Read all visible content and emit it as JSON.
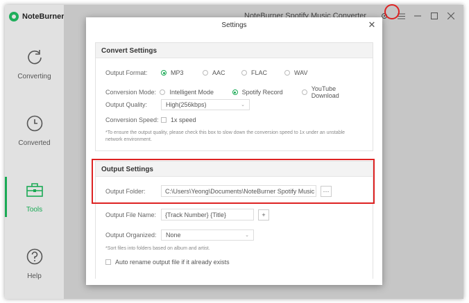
{
  "app": {
    "brand": "NoteBurner",
    "window_title": "NoteBurner Spotify Music Converter"
  },
  "sidebar": {
    "items": [
      {
        "label": "Converting",
        "icon": "refresh-icon"
      },
      {
        "label": "Converted",
        "icon": "clock-icon"
      },
      {
        "label": "Tools",
        "icon": "toolbox-icon"
      },
      {
        "label": "Help",
        "icon": "help-icon"
      }
    ],
    "active": "Tools"
  },
  "window_controls": {
    "settings_icon": "gear-icon",
    "menu_icon": "menu-icon",
    "minimize_icon": "minimize-icon",
    "maximize_icon": "maximize-icon",
    "close_icon": "close-icon"
  },
  "dialog": {
    "title": "Settings",
    "convert_settings": {
      "heading": "Convert Settings",
      "output_format": {
        "label": "Output Format:",
        "options": [
          "MP3",
          "AAC",
          "FLAC",
          "WAV"
        ],
        "selected": "MP3"
      },
      "conversion_mode": {
        "label": "Conversion Mode:",
        "options": [
          "Intelligent Mode",
          "Spotify Record",
          "YouTube Download"
        ],
        "selected": "Spotify Record"
      },
      "output_quality": {
        "label": "Output Quality:",
        "value": "High(256kbps)"
      },
      "conversion_speed": {
        "label": "Conversion Speed:",
        "checkbox_label": "1x speed",
        "checked": false
      },
      "speed_note": "*To ensure the output quality, please check this box to slow down the conversion speed to 1x under an unstable network environment."
    },
    "output_settings": {
      "heading": "Output Settings",
      "output_folder": {
        "label": "Output Folder:",
        "value": "C:\\Users\\Yeong\\Documents\\NoteBurner Spotify Music C",
        "browse_label": "···"
      },
      "output_file_name": {
        "label": "Output File Name:",
        "value": "{Track Number} {Title}",
        "add_label": "+"
      },
      "output_organized": {
        "label": "Output Organized:",
        "value": "None"
      },
      "organize_note": "*Sort files into folders based on album and artist.",
      "auto_rename": {
        "label": "Auto rename output file if it already exists",
        "checked": false
      }
    }
  },
  "colors": {
    "accent": "#1aaa55",
    "highlight": "#dd2222"
  }
}
